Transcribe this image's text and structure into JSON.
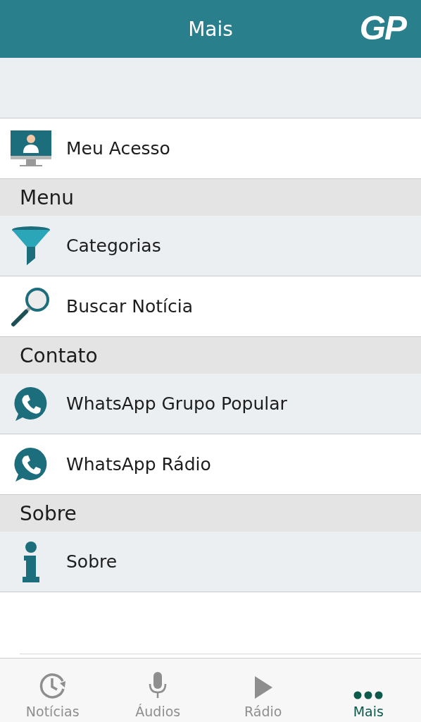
{
  "header": {
    "title": "Mais",
    "logo": "GP"
  },
  "top_item": {
    "label": "Meu Acesso",
    "kind": "monitor"
  },
  "sections": [
    {
      "title": "Menu",
      "items": [
        {
          "label": "Categorias",
          "kind": "funnel"
        },
        {
          "label": "Buscar Notícia",
          "kind": "search"
        }
      ]
    },
    {
      "title": "Contato",
      "items": [
        {
          "label": "WhatsApp Grupo Popular",
          "kind": "chat"
        },
        {
          "label": "WhatsApp Rádio",
          "kind": "chat"
        }
      ]
    },
    {
      "title": "Sobre",
      "items": [
        {
          "label": "Sobre",
          "kind": "info"
        }
      ]
    }
  ],
  "tabs": [
    {
      "label": "Notícias",
      "kind": "clock",
      "selected": false
    },
    {
      "label": "Áudios",
      "kind": "mic",
      "selected": false
    },
    {
      "label": "Rádio",
      "kind": "play",
      "selected": false
    },
    {
      "label": "Mais",
      "kind": "dots",
      "selected": true
    }
  ]
}
